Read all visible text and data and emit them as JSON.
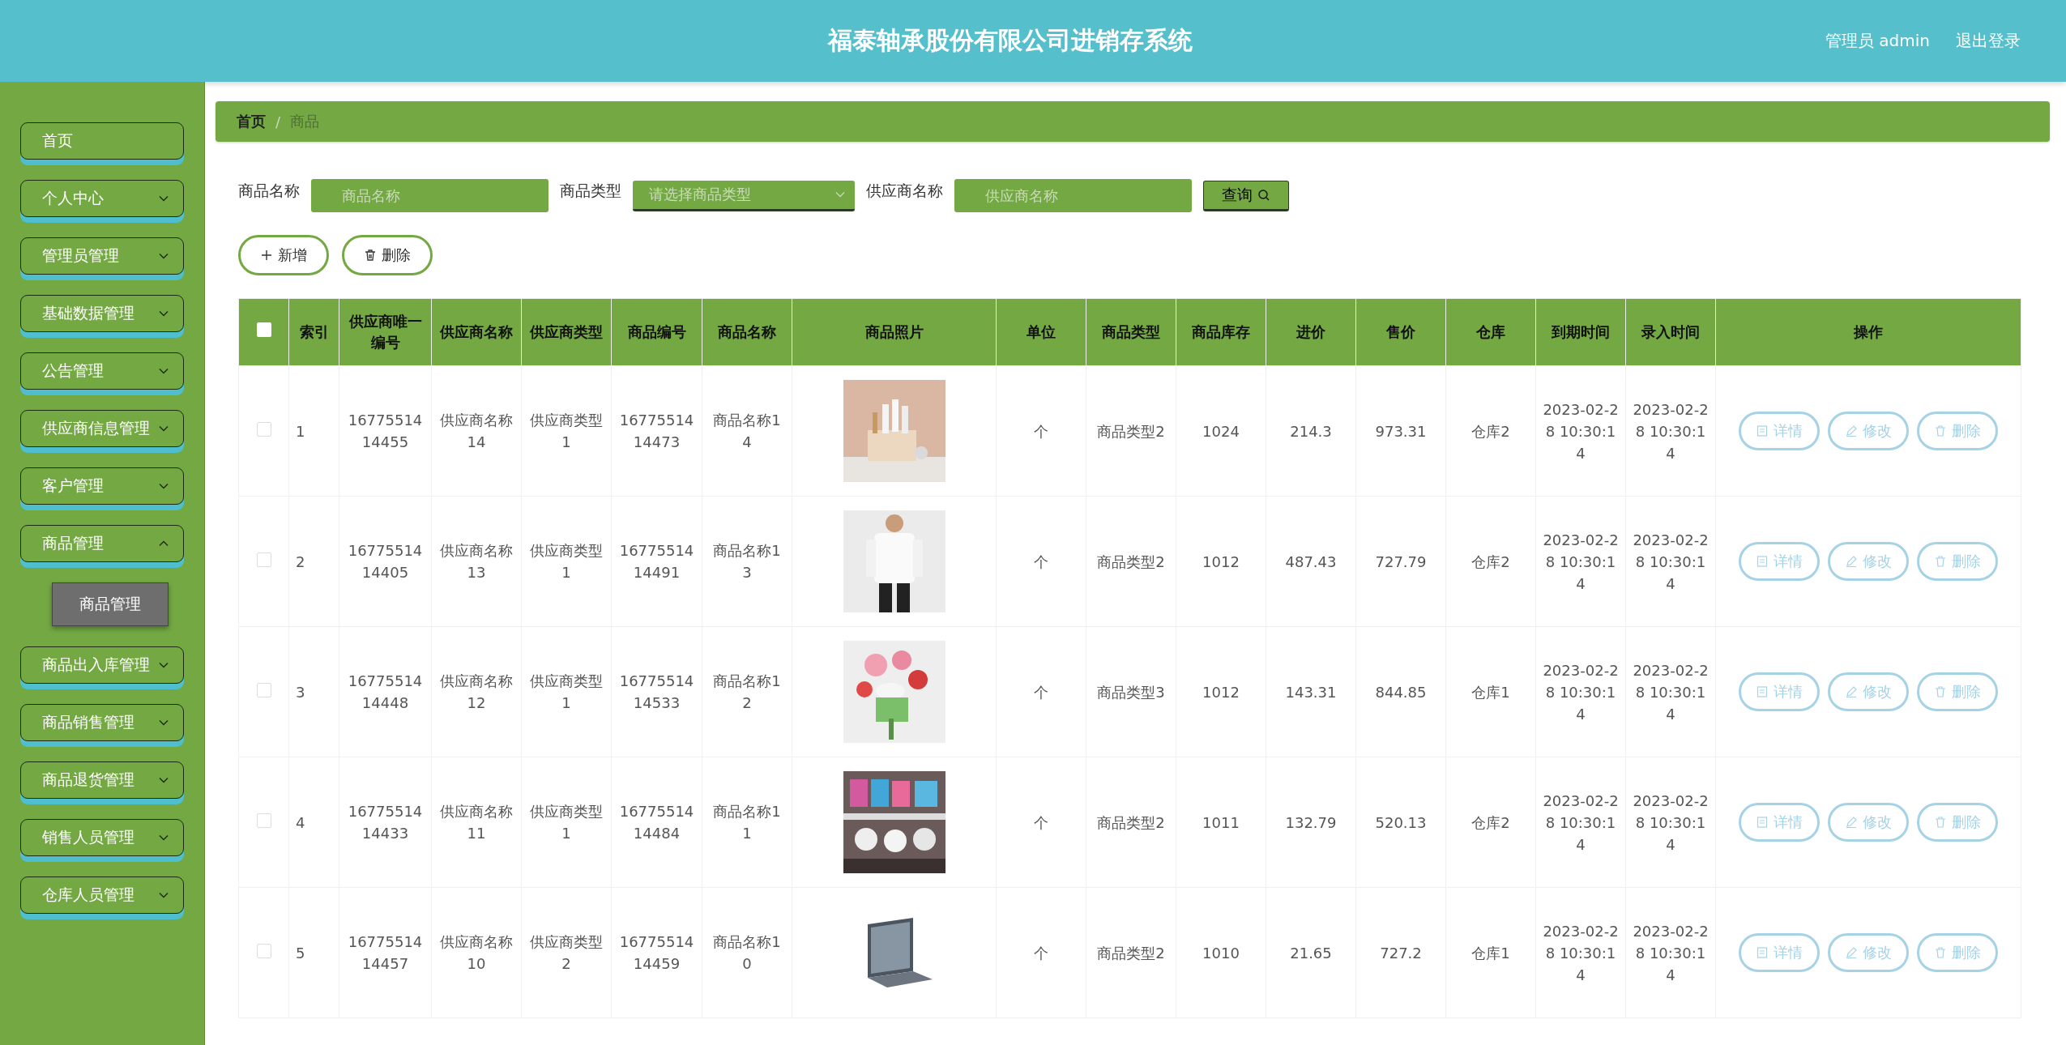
{
  "header": {
    "title": "福泰轴承股份有限公司进销存系统",
    "user": "管理员 admin",
    "logout": "退出登录"
  },
  "sidebar": {
    "items": [
      {
        "label": "首页",
        "expandable": false
      },
      {
        "label": "个人中心",
        "expandable": true,
        "expanded": false
      },
      {
        "label": "管理员管理",
        "expandable": true,
        "expanded": false
      },
      {
        "label": "基础数据管理",
        "expandable": true,
        "expanded": false
      },
      {
        "label": "公告管理",
        "expandable": true,
        "expanded": false
      },
      {
        "label": "供应商信息管理",
        "expandable": true,
        "expanded": false
      },
      {
        "label": "客户管理",
        "expandable": true,
        "expanded": false
      },
      {
        "label": "商品管理",
        "expandable": true,
        "expanded": true,
        "children": [
          {
            "label": "商品管理",
            "selected": true
          }
        ]
      },
      {
        "label": "商品出入库管理",
        "expandable": true,
        "expanded": false
      },
      {
        "label": "商品销售管理",
        "expandable": true,
        "expanded": false
      },
      {
        "label": "商品退货管理",
        "expandable": true,
        "expanded": false
      },
      {
        "label": "销售人员管理",
        "expandable": true,
        "expanded": false
      },
      {
        "label": "仓库人员管理",
        "expandable": true,
        "expanded": false
      }
    ]
  },
  "breadcrumb": [
    "首页",
    "商品"
  ],
  "breadcrumb_separator": "/",
  "search": [
    {
      "label": "商品名称",
      "kind": "input",
      "placeholder": "商品名称"
    },
    {
      "label": "商品类型",
      "kind": "select",
      "placeholder": "请选择商品类型"
    },
    {
      "label": "供应商名称",
      "kind": "input",
      "placeholder": "供应商名称"
    }
  ],
  "search_button": "查询",
  "toolbar": [
    "新增",
    "删除"
  ],
  "table": {
    "select_all": false,
    "columns": [
      "索引",
      "供应商唯一编号",
      "供应商名称",
      "供应商类型",
      "商品编号",
      "商品名称",
      "商品照片",
      "单位",
      "商品类型",
      "商品库存",
      "进价",
      "售价",
      "仓库",
      "到期时间",
      "录入时间",
      "操作"
    ],
    "rows": [
      {
        "checked": false,
        "cells": [
          "1",
          "1677551414455",
          "供应商名称14",
          "供应商类型1",
          "1677551414473",
          "商品名称14",
          {
            "kind": "picture"
          },
          "个",
          "商品类型2",
          "1024",
          "214.3",
          "973.31",
          "仓库2",
          "2023-02-28 10:30:14",
          "2023-02-28 10:30:14"
        ],
        "actions": [
          "详情",
          "修改",
          "删除"
        ]
      },
      {
        "checked": false,
        "cells": [
          "2",
          "1677551414405",
          "供应商名称13",
          "供应商类型1",
          "1677551414491",
          "商品名称13",
          {
            "kind": "picture"
          },
          "个",
          "商品类型2",
          "1012",
          "487.43",
          "727.79",
          "仓库2",
          "2023-02-28 10:30:14",
          "2023-02-28 10:30:14"
        ],
        "actions": [
          "详情",
          "修改",
          "删除"
        ]
      },
      {
        "checked": false,
        "cells": [
          "3",
          "1677551414448",
          "供应商名称12",
          "供应商类型1",
          "1677551414533",
          "商品名称12",
          {
            "kind": "picture"
          },
          "个",
          "商品类型3",
          "1012",
          "143.31",
          "844.85",
          "仓库1",
          "2023-02-28 10:30:14",
          "2023-02-28 10:30:14"
        ],
        "actions": [
          "详情",
          "修改",
          "删除"
        ]
      },
      {
        "checked": false,
        "cells": [
          "4",
          "1677551414433",
          "供应商名称11",
          "供应商类型1",
          "1677551414484",
          "商品名称11",
          {
            "kind": "picture"
          },
          "个",
          "商品类型2",
          "1011",
          "132.79",
          "520.13",
          "仓库2",
          "2023-02-28 10:30:14",
          "2023-02-28 10:30:14"
        ],
        "actions": [
          "详情",
          "修改",
          "删除"
        ]
      },
      {
        "checked": false,
        "cells": [
          "5",
          "1677551414457",
          "供应商名称10",
          "供应商类型2",
          "1677551414459",
          "商品名称10",
          {
            "kind": "picture"
          },
          "个",
          "商品类型2",
          "1010",
          "21.65",
          "727.2",
          "仓库1",
          "2023-02-28 10:30:14",
          "2023-02-28 10:30:14"
        ],
        "actions": [
          "详情",
          "修改",
          "删除"
        ]
      }
    ]
  }
}
